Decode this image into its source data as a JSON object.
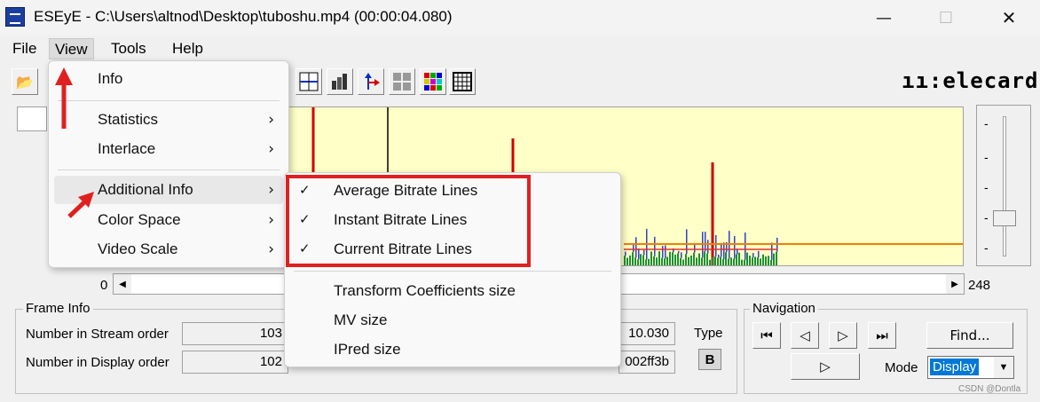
{
  "window": {
    "title": "ESEyE - C:\\Users\\altnod\\Desktop\\tuboshu.mp4 (00:00:04.080)",
    "minimize": "—",
    "maximize": "☐",
    "close": "✕"
  },
  "menubar": {
    "file": "File",
    "view": "View",
    "tools": "Tools",
    "help": "Help"
  },
  "toolbar": {
    "open_icon": "📂",
    "logo": "ıı:elecard"
  },
  "graph": {
    "range_start": "0",
    "range_end": "248"
  },
  "view_menu": {
    "items": [
      {
        "label": "Info",
        "submenu": false
      },
      {
        "label": "Statistics",
        "submenu": true
      },
      {
        "label": "Interlace",
        "submenu": true
      },
      {
        "label": "Additional Info",
        "submenu": true
      },
      {
        "label": "Color Space",
        "submenu": true
      },
      {
        "label": "Video Scale",
        "submenu": true
      }
    ],
    "arrow": "›"
  },
  "additional_info_menu": {
    "check": "✓",
    "items": [
      {
        "label": "Average Bitrate Lines",
        "checked": true
      },
      {
        "label": "Instant Bitrate Lines",
        "checked": true
      },
      {
        "label": "Current Bitrate Lines",
        "checked": true
      },
      {
        "label": "Transform Coefficients size",
        "checked": false
      },
      {
        "label": "MV size",
        "checked": false
      },
      {
        "label": "IPred size",
        "checked": false
      }
    ]
  },
  "frame_info": {
    "title": "Frame Info",
    "stream_order_label": "Number in Stream order",
    "stream_order_value": "103",
    "display_order_label": "Number in Display order",
    "display_order_value": "102",
    "time_value": "10.030",
    "address_value": "002ff3b",
    "type_label": "Type",
    "type_value": "B"
  },
  "navigation": {
    "title": "Navigation",
    "find_label": "Find...",
    "mode_label": "Mode",
    "mode_value": "Display",
    "first_icon": "⏮",
    "prev_icon": "◁",
    "next_icon": "▷",
    "last_icon": "⏭",
    "play_icon": "▷"
  },
  "watermark": "CSDN @Dontla"
}
